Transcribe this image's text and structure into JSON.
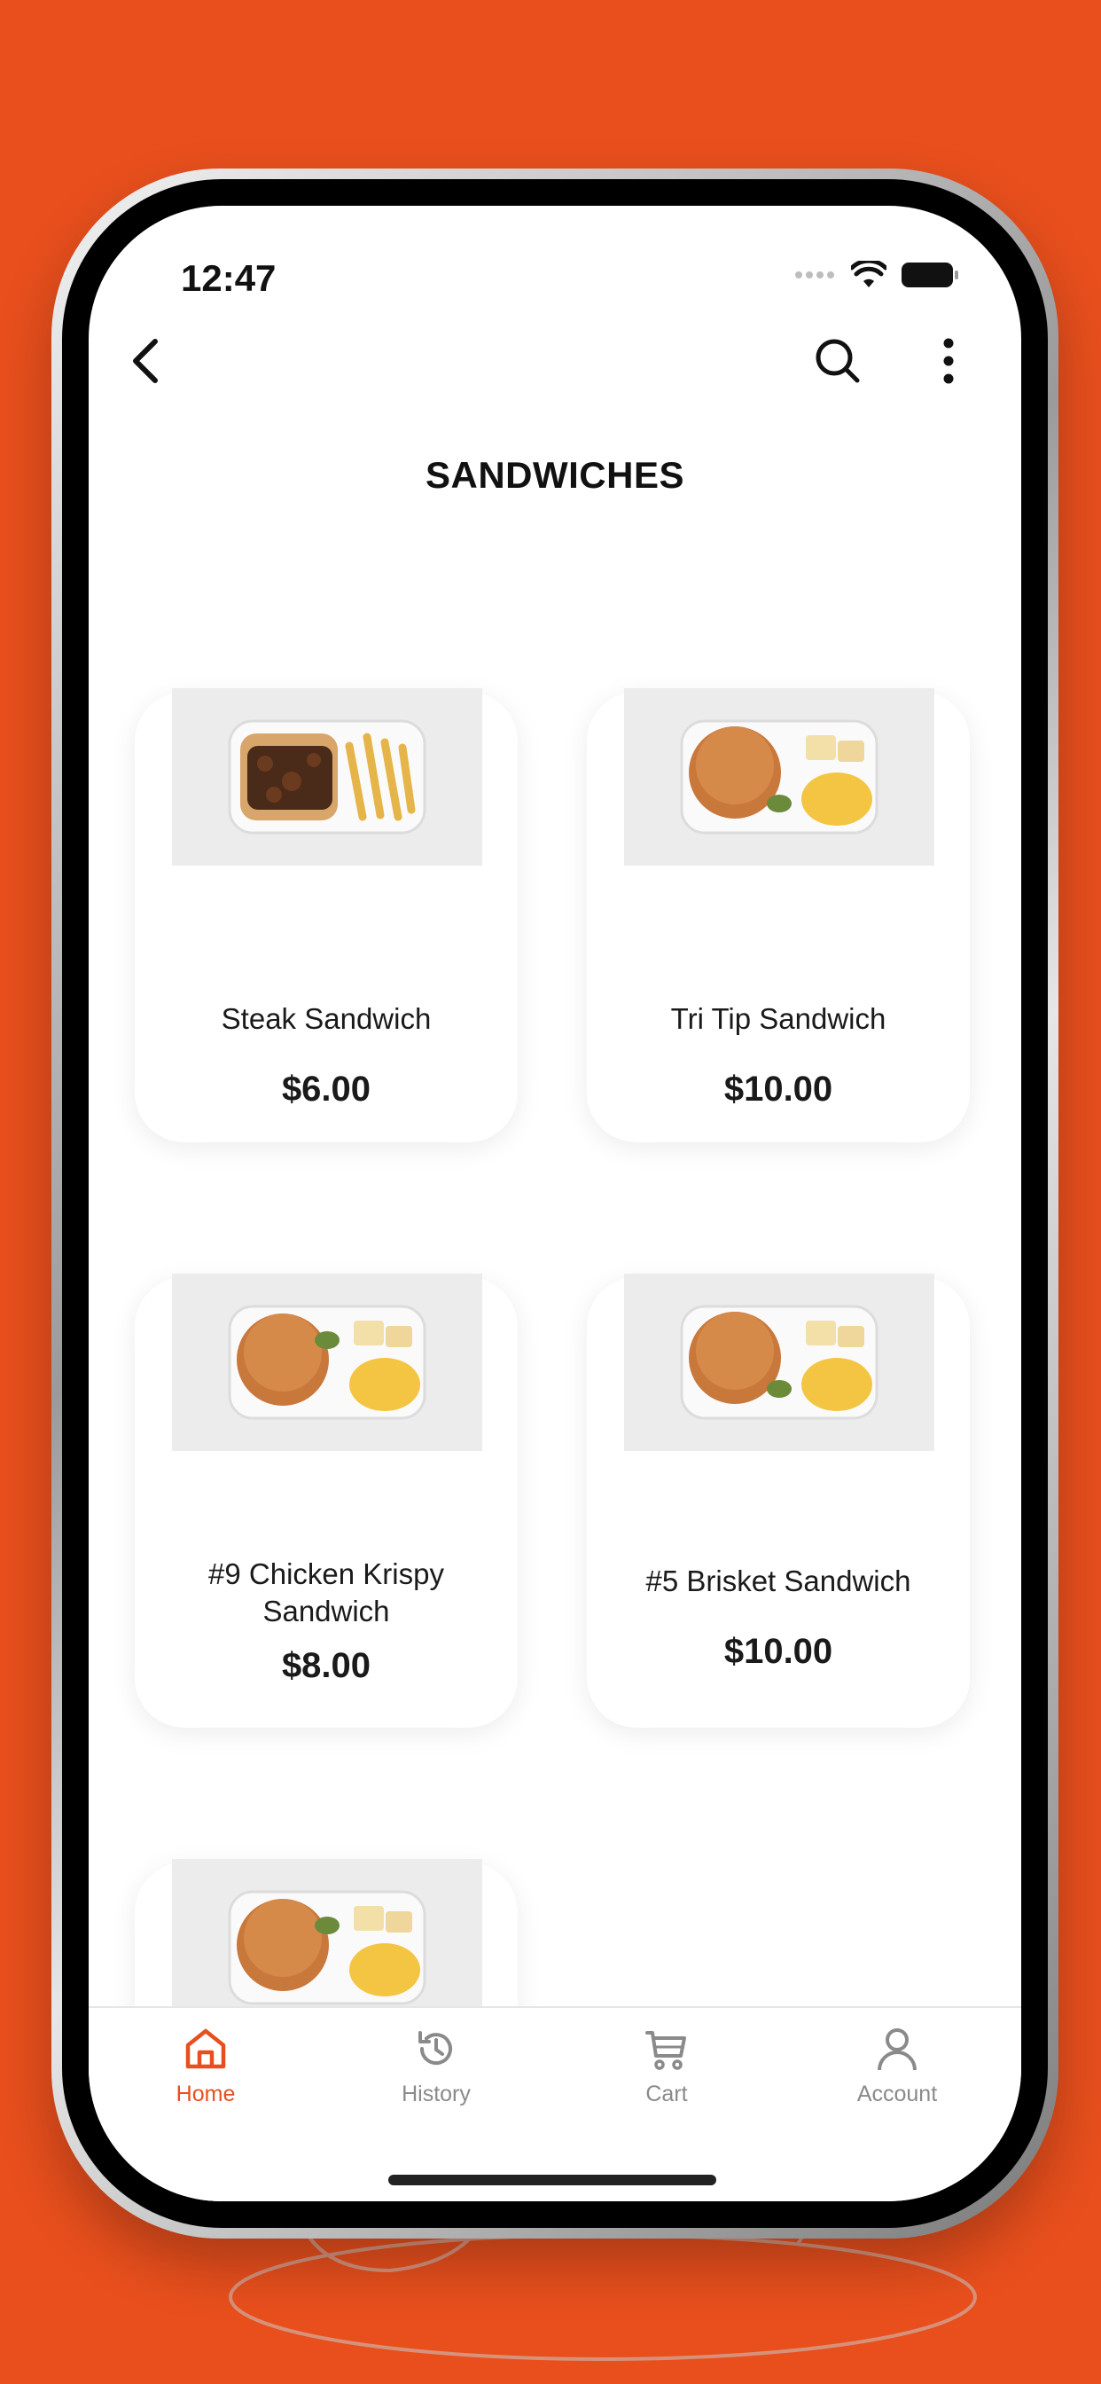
{
  "status": {
    "time": "12:47"
  },
  "header": {
    "title": "SANDWICHES"
  },
  "items": [
    {
      "name": "Steak Sandwich",
      "price": "$6.00",
      "image": "steak-fries"
    },
    {
      "name": "Tri Tip Sandwich",
      "price": "$10.00",
      "image": "burger-mac"
    },
    {
      "name": "#9 Chicken Krispy Sandwich",
      "price": "$8.00",
      "image": "burger-mac"
    },
    {
      "name": "#5 Brisket Sandwich",
      "price": "$10.00",
      "image": "burger-mac"
    },
    {
      "name": "",
      "price": "",
      "image": "burger-mac"
    }
  ],
  "nav": {
    "home": "Home",
    "history": "History",
    "cart": "Cart",
    "account": "Account"
  },
  "colors": {
    "accent": "#e84f1d",
    "inactive": "#8a8a8a"
  },
  "icons": [
    "back-arrow-icon",
    "search-icon",
    "more-vertical-icon",
    "home-icon",
    "history-icon",
    "cart-icon",
    "account-icon",
    "wifi-icon",
    "battery-icon",
    "signal-icon"
  ]
}
